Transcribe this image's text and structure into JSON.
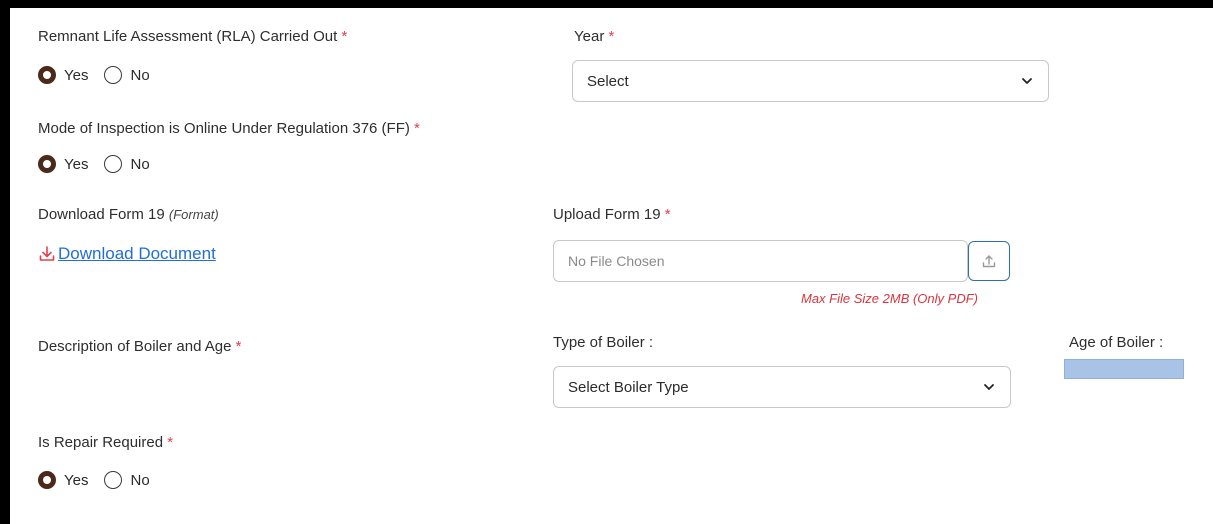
{
  "rla": {
    "label": "Remnant Life Assessment (RLA) Carried Out",
    "required_mark": "*",
    "options": [
      "Yes",
      "No"
    ],
    "selected": "Yes"
  },
  "year": {
    "label": "Year",
    "required_mark": "*",
    "value": "Select"
  },
  "inspection_mode": {
    "label": "Mode of Inspection is Online Under Regulation 376 (FF)",
    "required_mark": "*",
    "options": [
      "Yes",
      "No"
    ],
    "selected": "Yes"
  },
  "download_form": {
    "label": "Download Form 19",
    "hint": "(Format)",
    "link_text": "Download Document"
  },
  "upload_form": {
    "label": "Upload Form 19",
    "required_mark": "*",
    "placeholder": "No File Chosen",
    "max_size_note": "Max File Size 2MB (Only PDF)"
  },
  "boiler": {
    "description_label": "Description of Boiler and Age",
    "required_mark": "*",
    "type_label": "Type of Boiler :",
    "type_value": "Select Boiler Type",
    "age_label": "Age of Boiler :",
    "age_value": ""
  },
  "repair": {
    "label": "Is Repair Required",
    "required_mark": "*",
    "options": [
      "Yes",
      "No"
    ],
    "selected": "Yes"
  },
  "colors": {
    "required": "#e0424f",
    "radio_selected": "#4a2a1a",
    "link": "#1f6fd6",
    "error_text": "#d9343f",
    "upload_border": "#2d6fb6",
    "age_field": "#a9c3e6"
  },
  "icons": {
    "select_chevron": "chevron-down-icon",
    "download": "download-icon",
    "upload": "upload-icon"
  }
}
